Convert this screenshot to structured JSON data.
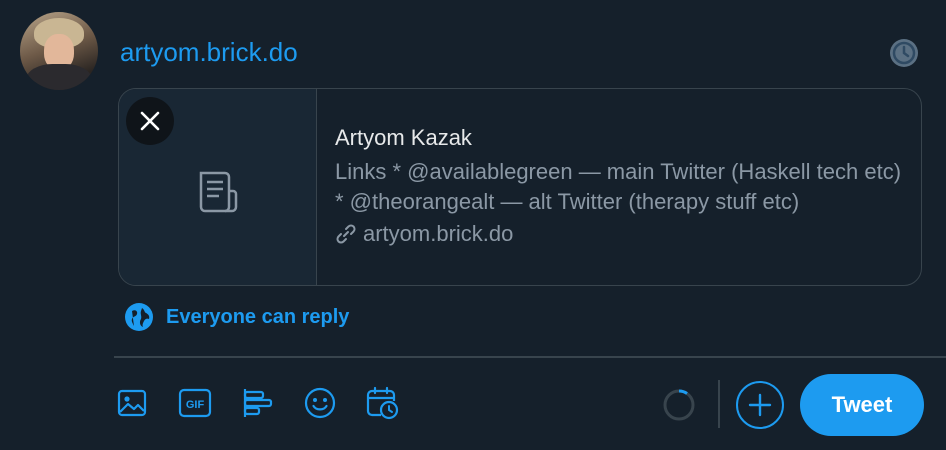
{
  "composer": {
    "text": "artyom.brick.do",
    "avatar_icon": "user-avatar-photo",
    "schedule_icon": "clock-icon"
  },
  "link_card": {
    "title": "Artyom Kazak",
    "description": "Links * @availablegreen — main Twitter (Haskell tech etc) * @theorangealt — alt Twitter (therapy stuff etc)",
    "domain": "artyom.brick.do",
    "thumbnail_icon": "document-icon",
    "remove_icon": "close-icon"
  },
  "reply": {
    "label": "Everyone can reply",
    "icon": "globe-icon"
  },
  "toolbar": {
    "icons": [
      "image-icon",
      "gif-icon",
      "poll-icon",
      "emoji-icon",
      "schedule-icon"
    ],
    "gif_text": "GIF",
    "tweet_label": "Tweet",
    "accent": "#1d9bf0",
    "background": "#15202b"
  }
}
